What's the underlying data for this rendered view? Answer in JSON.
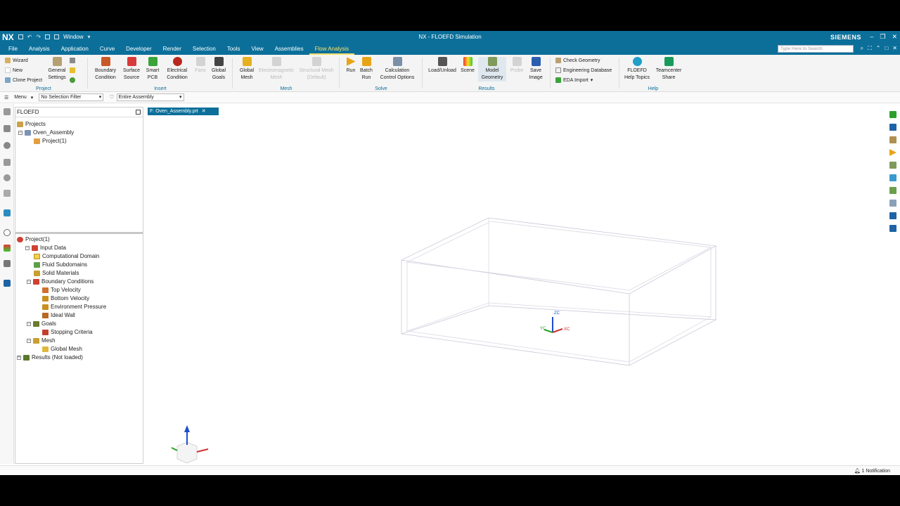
{
  "app": {
    "logo": "NX",
    "window_title": "NX - FLOEFD Simulation",
    "brand": "SIEMENS",
    "window_menu": "Window",
    "search_placeholder": "Type Here to Search"
  },
  "menu_tabs": [
    "File",
    "Analysis",
    "Application",
    "Curve",
    "Developer",
    "Render",
    "Selection",
    "Tools",
    "View",
    "Assemblies",
    "Flow Analysis"
  ],
  "active_tab": "Flow Analysis",
  "ribbon": {
    "project": {
      "label": "Project",
      "wizard": "Wizard",
      "new": "New",
      "clone": "Clone Project",
      "general_settings": [
        "General",
        "Settings"
      ]
    },
    "insert": {
      "label": "Insert",
      "boundary": [
        "Boundary",
        "Condition"
      ],
      "surface": [
        "Surface",
        "Source"
      ],
      "smart_pcb": [
        "Smart",
        "PCB"
      ],
      "electrical": [
        "Electrical",
        "Condition"
      ],
      "fans": [
        "Fans",
        ""
      ],
      "goals": [
        "Global",
        "Goals"
      ]
    },
    "mesh": {
      "label": "Mesh",
      "global_mesh": [
        "Global",
        "Mesh"
      ],
      "em_mesh": [
        "Electromagnetic",
        "Mesh"
      ],
      "struct_mesh": [
        "Structural Mesh",
        "(Default)"
      ]
    },
    "solve": {
      "label": "Solve",
      "run": [
        "Run",
        ""
      ],
      "batch": [
        "Batch",
        "Run"
      ],
      "calc": [
        "Calculation",
        "Control Options"
      ]
    },
    "results": {
      "label": "Results",
      "load": [
        "Load/Unload",
        ""
      ],
      "scene": [
        "Scene",
        ""
      ],
      "model": [
        "Model",
        "Geometry"
      ],
      "probe": [
        "Probe",
        ""
      ],
      "save_image": [
        "Save",
        "Image"
      ]
    },
    "tools": {
      "check_geometry": "Check Geometry",
      "eng_database": "Engineering Database",
      "eda_import": "EDA Import"
    },
    "help": {
      "label": "Help",
      "help_topics": [
        "FLOEFD",
        "Help Topics"
      ],
      "teamcenter": [
        "Teamcenter",
        "Share"
      ]
    }
  },
  "toolbar": {
    "menu": "Menu",
    "selection_filter": "No Selection Filter",
    "scope": "Entire Assembly"
  },
  "navigator": {
    "title": "FLOEFD",
    "top_tree": [
      {
        "label": "Projects",
        "level": 0
      },
      {
        "label": "Oven_Assembly",
        "level": 1
      },
      {
        "label": "Project(1)",
        "level": 2
      }
    ],
    "bottom_tree": [
      {
        "label": "Project(1)",
        "level": 0
      },
      {
        "label": "Input Data",
        "level": 1
      },
      {
        "label": "Computational Domain",
        "level": 2
      },
      {
        "label": "Fluid Subdomains",
        "level": 2
      },
      {
        "label": "Solid Materials",
        "level": 2
      },
      {
        "label": "Boundary Conditions",
        "level": 2
      },
      {
        "label": "Top Velocity",
        "level": 3
      },
      {
        "label": "Bottom Velocity",
        "level": 3
      },
      {
        "label": "Environment Pressure",
        "level": 3
      },
      {
        "label": "Ideal Wall",
        "level": 3
      },
      {
        "label": "Goals",
        "level": 2
      },
      {
        "label": "Stopping Criteria",
        "level": 3
      },
      {
        "label": "Mesh",
        "level": 2
      },
      {
        "label": "Global Mesh",
        "level": 3
      },
      {
        "label": "Results (Not loaded)",
        "level": 0
      }
    ]
  },
  "document_tab": "Oven_Assembly.prt",
  "axes": {
    "x": "XC",
    "y": "YC",
    "z": "ZC"
  },
  "status": {
    "notification": "1 Notification"
  },
  "colors": {
    "brand": "#0b6f9a",
    "active_tab": "#ffe16b"
  }
}
